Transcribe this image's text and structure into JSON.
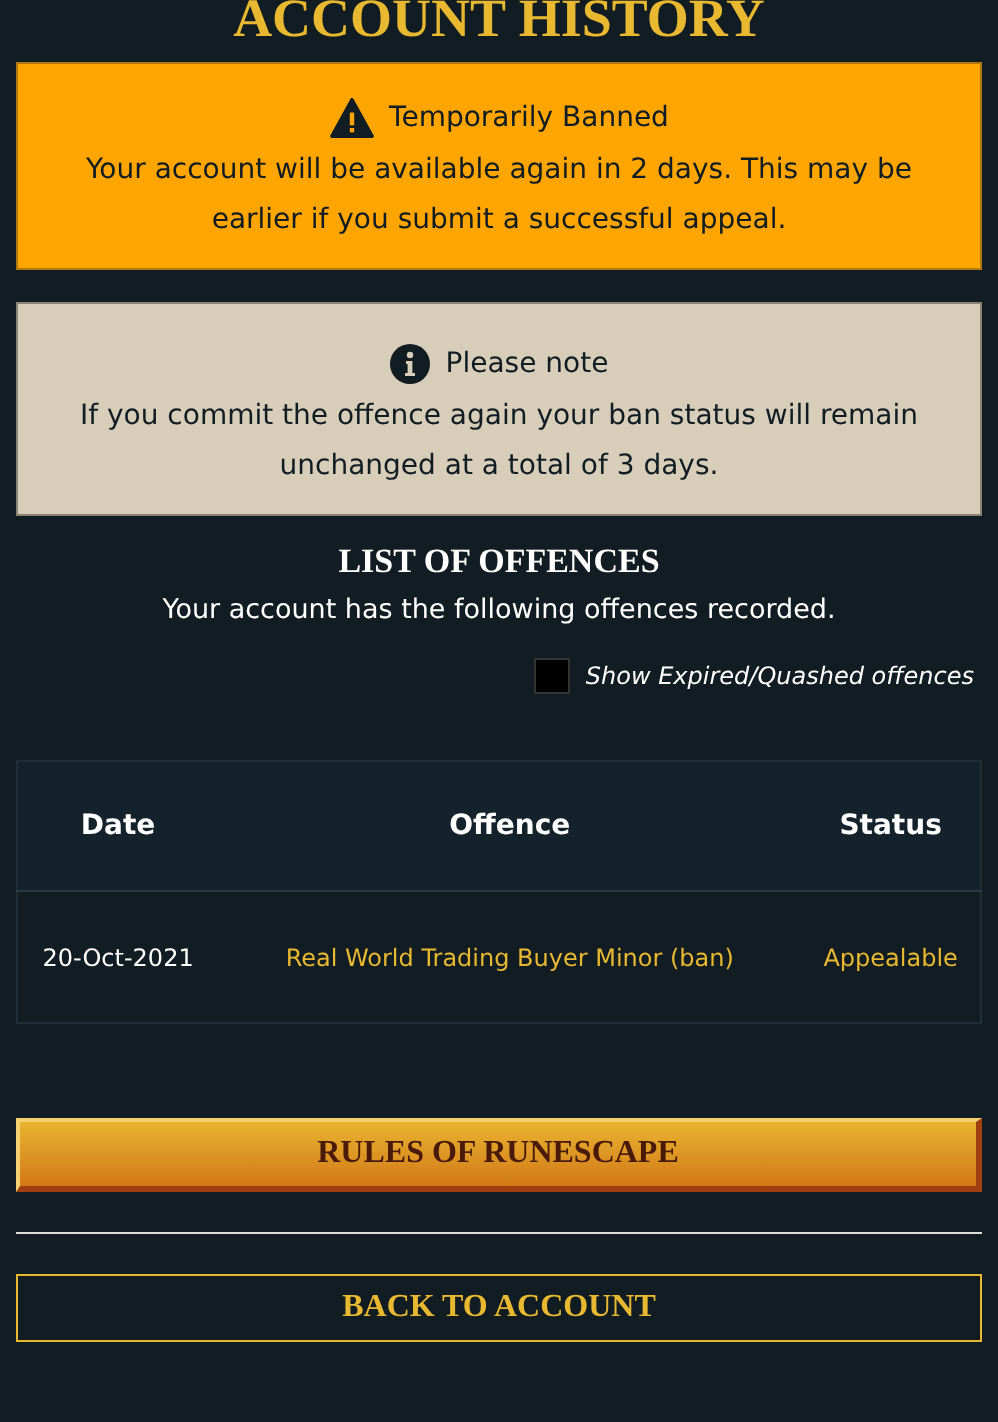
{
  "page_title": "ACCOUNT HISTORY",
  "alerts": [
    {
      "kind": "warning",
      "title": "Temporarily Banned",
      "message": "Your account will be available again in 2 days. This may be earlier if you submit a successful appeal."
    },
    {
      "kind": "info",
      "title": "Please note",
      "message": "If you commit the offence again your ban status will remain unchanged at a total of 3 days."
    }
  ],
  "offences": {
    "heading": "LIST OF OFFENCES",
    "subtitle": "Your account has the following offences recorded.",
    "filter": {
      "label": "Show Expired/Quashed offences",
      "checked": false
    },
    "table": {
      "columns": [
        "Date",
        "Offence",
        "Status"
      ],
      "rows": [
        [
          "20-Oct-2021",
          "Real World Trading Buyer Minor (ban)",
          "Appealable"
        ]
      ]
    }
  },
  "buttons": [
    {
      "kind": "primary",
      "label": "RULES OF RUNESCAPE"
    },
    {
      "kind": "outline",
      "label": "BACK TO ACCOUNT"
    }
  ]
}
